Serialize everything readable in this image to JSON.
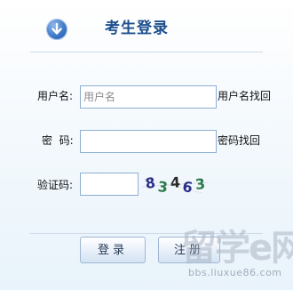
{
  "header": {
    "title": "考生登录",
    "icon": "arrow-down-circle-icon",
    "accent_color": "#1c4f8e"
  },
  "form": {
    "username": {
      "label": "用户名:",
      "placeholder": "用户名",
      "value": "",
      "link": "用户名找回"
    },
    "password": {
      "label": "密  码:",
      "value": "",
      "link": "密码找回"
    },
    "captcha": {
      "label": "验证码:",
      "value": "",
      "image_text": "83463",
      "chars": [
        "8",
        "3",
        "4",
        "6",
        "3"
      ],
      "char_colors": [
        "#2c2f88",
        "#2a7a4a",
        "#2a2a2a",
        "#2c2f88",
        "#2a7a4a"
      ]
    }
  },
  "actions": {
    "login_label": "登录",
    "second_label": "注册"
  },
  "watermark": {
    "brand": "留学e网",
    "url": "bbs.liuxue86.com"
  }
}
